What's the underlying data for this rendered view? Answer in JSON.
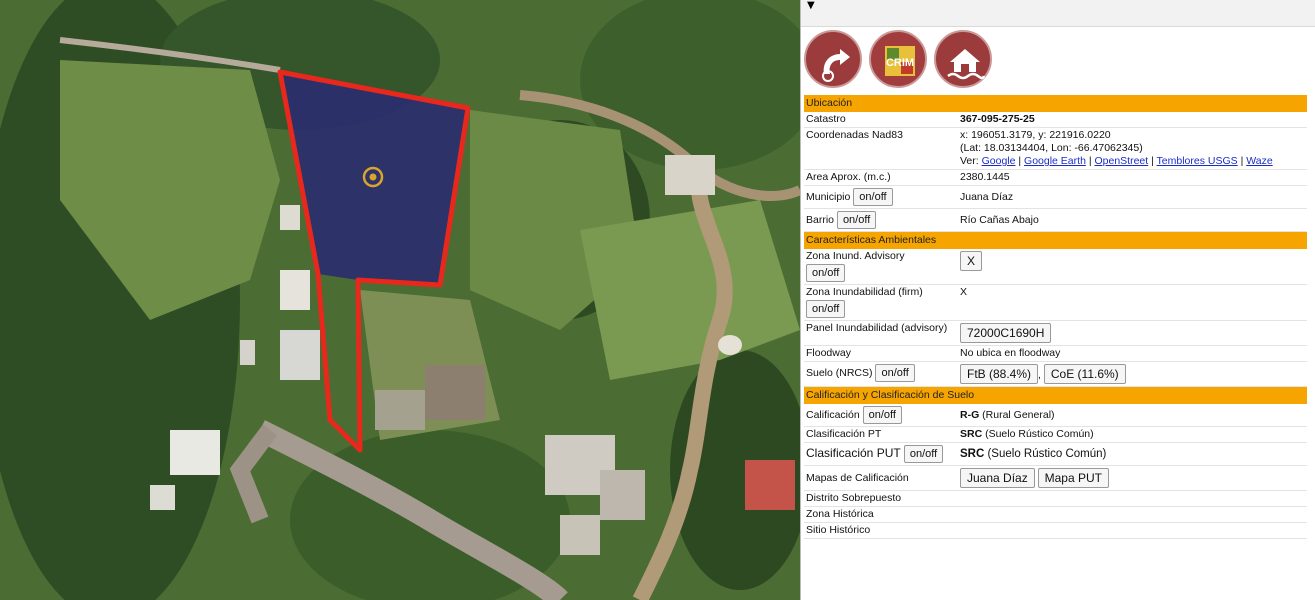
{
  "map": {
    "description_icons": [
      "parcel-polygon",
      "parcel-center-marker"
    ]
  },
  "panel": {
    "icons": [
      "redo-arrow-icon",
      "crim-logo-icon",
      "house-flood-icon"
    ],
    "crim_logo_text": "CRIM",
    "sections": {
      "ubicacion": "Ubicación",
      "caracteristicas": "Características Ambientales",
      "calificacion": "Calificación y Clasificación de Suelo"
    },
    "rows": {
      "catastro_label": "Catastro",
      "catastro_value": "367-095-275-25",
      "coords_label": "Coordenadas Nad83",
      "coords_line1": "x: 196051.3179, y: 221916.0220",
      "coords_line2": "(Lat: 18.03134404, Lon: -66.47062345)",
      "ver_label": "Ver:",
      "ver_links": [
        "Google",
        "Google Earth",
        "OpenStreet",
        "Temblores USGS",
        "Waze"
      ],
      "area_label": "Area Aprox. (m.c.)",
      "area_value": "2380.1445",
      "municipio_label": "Municipio",
      "municipio_value": "Juana Díaz",
      "barrio_label": "Barrio",
      "barrio_value": "Río Cañas Abajo",
      "zona_advisory_label": "Zona Inund. Advisory",
      "zona_advisory_value": "X",
      "zona_firm_label": "Zona Inundabilidad (firm)",
      "zona_firm_value": "X",
      "panel_label": "Panel Inundabilidad (advisory)",
      "panel_value": "72000C1690H",
      "floodway_label": "Floodway",
      "floodway_value": "No ubica en floodway",
      "suelo_label": "Suelo (NRCS)",
      "suelo_value1": "FtB (88.4%)",
      "suelo_sep": ",",
      "suelo_value2": "CoE (11.6%)",
      "calif_label": "Calificación",
      "calif_code": "R-G",
      "calif_desc": " (Rural General)",
      "clasif_pt_label": "Clasificación PT",
      "clasif_pt_code": "SRC",
      "clasif_pt_desc": " (Suelo Rústico Común)",
      "clasif_put_label": "Clasificación PUT",
      "clasif_put_code": "SRC",
      "clasif_put_desc": " (Suelo Rústico Común)",
      "mapas_label": "Mapas de Calificación",
      "mapas_btn1": "Juana Díaz",
      "mapas_btn2": "Mapa PUT",
      "distrito_label": "Distrito Sobrepuesto",
      "zona_hist_label": "Zona Histórica",
      "sitio_hist_label": "Sitio Histórico"
    },
    "onoff_label": "on/off"
  },
  "colors": {
    "section_bg": "#f5a400",
    "parcel_outline": "#e8281c",
    "parcel_fill": "#2a2f6e",
    "link": "#1a2cc8",
    "icon_circle": "#9b3b3b"
  }
}
